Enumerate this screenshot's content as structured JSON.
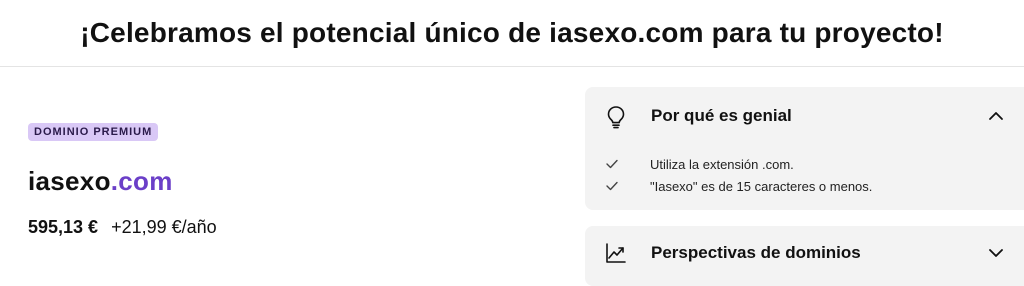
{
  "banner": {
    "title": "¡Celebramos el potencial único de iasexo.com para tu proyecto!"
  },
  "listing": {
    "badge": "DOMINIO PREMIUM",
    "domain_name": "iasexo",
    "domain_tld": ".com",
    "price": "595,13 €",
    "renewal": "+21,99 €/año",
    "tld_color": "#6b3fc8",
    "badge_color": "#d9c8f6"
  },
  "why_card": {
    "icon": "lightbulb-icon",
    "title": "Por qué es genial",
    "expanded": true,
    "items": [
      "Utiliza la extensión .com.",
      "\"Iasexo\" es de 15 caracteres o menos."
    ]
  },
  "insights_card": {
    "icon": "trending-chart-icon",
    "title": "Perspectivas de dominios",
    "expanded": false
  }
}
